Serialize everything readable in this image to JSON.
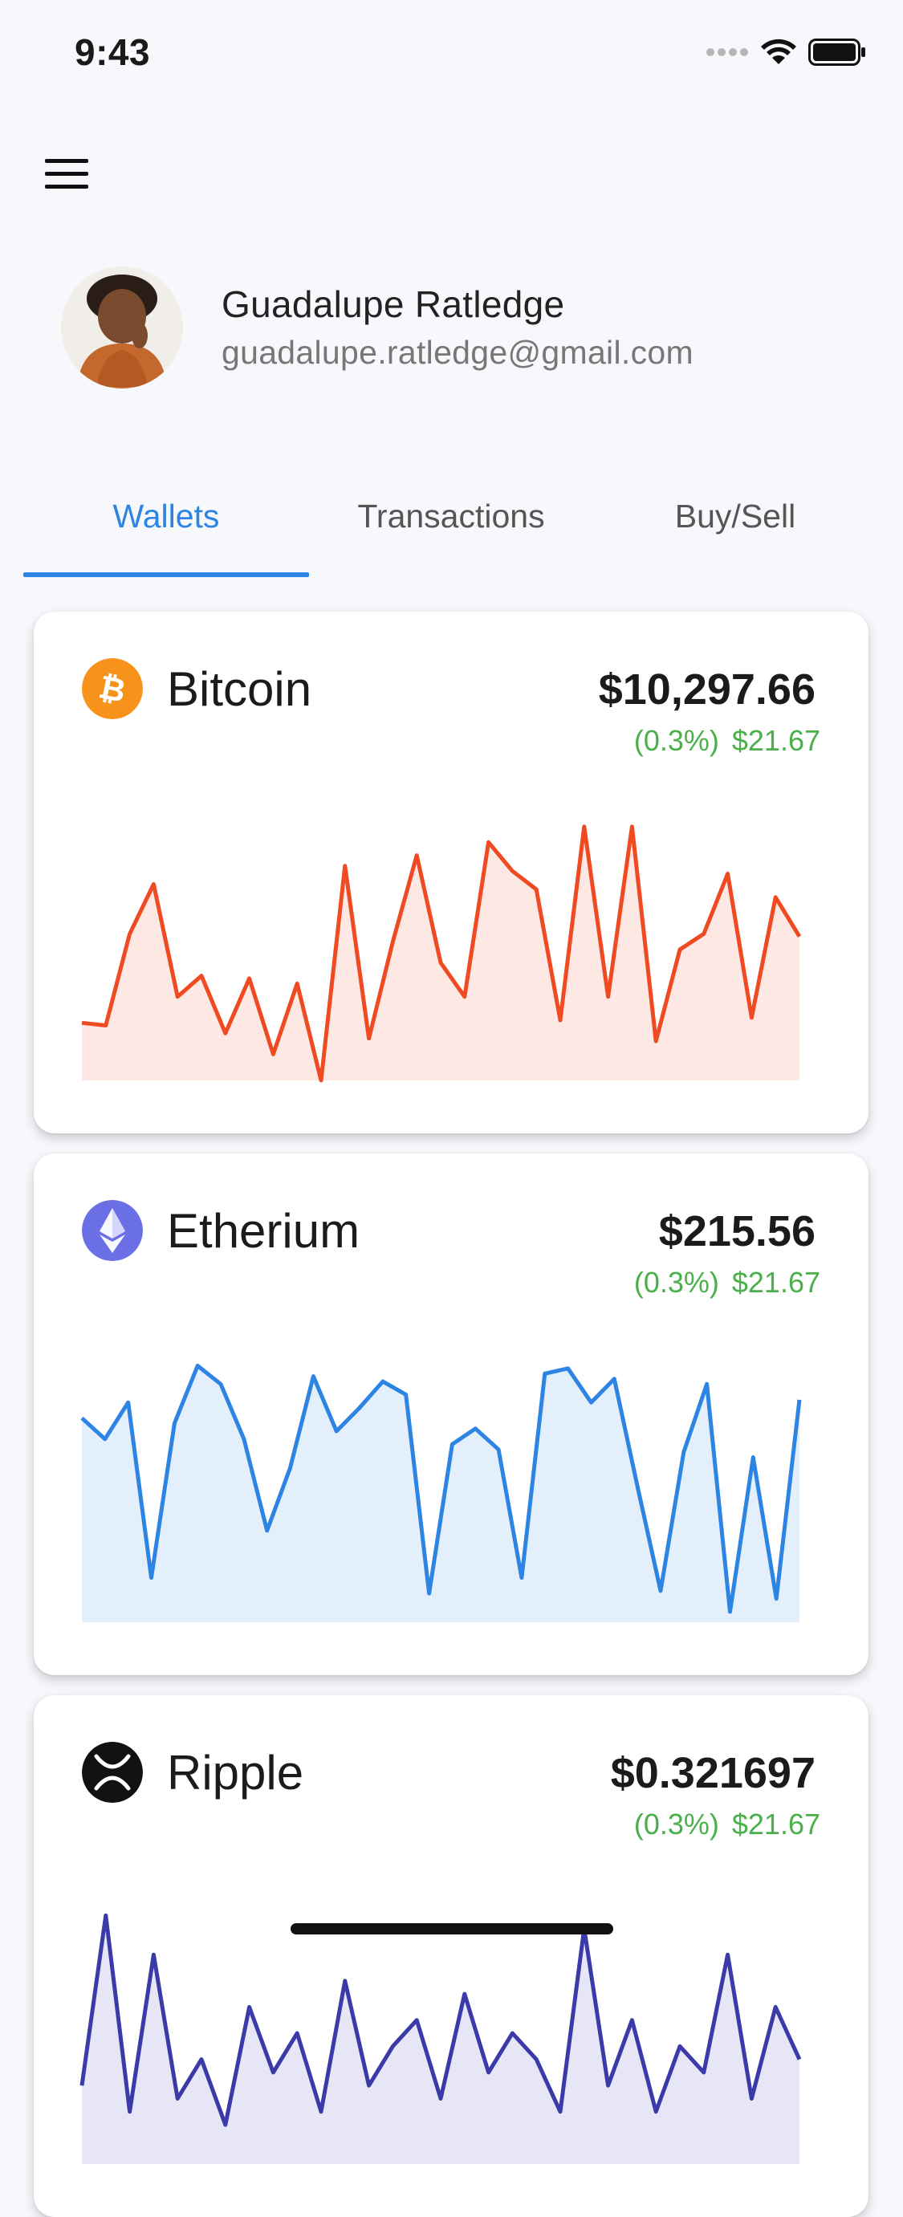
{
  "status": {
    "time": "9:43"
  },
  "profile": {
    "name": "Guadalupe Ratledge",
    "email": "guadalupe.ratledge@gmail.com"
  },
  "tabs": [
    {
      "label": "Wallets",
      "active": true
    },
    {
      "label": "Transactions",
      "active": false
    },
    {
      "label": "Buy/Sell",
      "active": false
    }
  ],
  "wallets": [
    {
      "name": "Bitcoin",
      "icon": "bitcoin-icon",
      "icon_color": "#f7931a",
      "price": "$10,297.66",
      "change_pct": "(0.3%)",
      "change_amt": "$21.67",
      "line_color": "#f04a23",
      "fill_color": "#fde8e3",
      "chart_data": {
        "type": "area",
        "values": [
          22,
          21,
          56,
          75,
          32,
          40,
          18,
          39,
          10,
          37,
          0,
          82,
          16,
          53,
          86,
          45,
          32,
          91,
          80,
          73,
          23,
          97,
          32,
          97,
          15,
          50,
          56,
          79,
          24,
          70,
          55
        ]
      }
    },
    {
      "name": "Etherium",
      "icon": "ethereum-icon",
      "icon_color": "#6a6fe6",
      "price": "$215.56",
      "change_pct": "(0.3%)",
      "change_amt": "$21.67",
      "line_color": "#2e84e3",
      "fill_color": "#e3effb",
      "chart_data": {
        "type": "area",
        "values": [
          78,
          70,
          84,
          17,
          76,
          98,
          91,
          70,
          35,
          59,
          94,
          73,
          82,
          92,
          87,
          11,
          68,
          74,
          66,
          17,
          95,
          97,
          84,
          93,
          52,
          12,
          65,
          91,
          4,
          63,
          9,
          85
        ]
      }
    },
    {
      "name": "Ripple",
      "icon": "ripple-icon",
      "icon_color": "#111111",
      "price": "$0.321697",
      "change_pct": "(0.3%)",
      "change_amt": "$21.67",
      "line_color": "#3a3aa8",
      "fill_color": "#e6e6f6",
      "chart_data": {
        "type": "area",
        "values": [
          30,
          95,
          20,
          80,
          25,
          40,
          15,
          60,
          35,
          50,
          20,
          70,
          30,
          45,
          55,
          25,
          65,
          35,
          50,
          40,
          20,
          90,
          30,
          55,
          20,
          45,
          35,
          80,
          25,
          60,
          40
        ]
      }
    }
  ]
}
